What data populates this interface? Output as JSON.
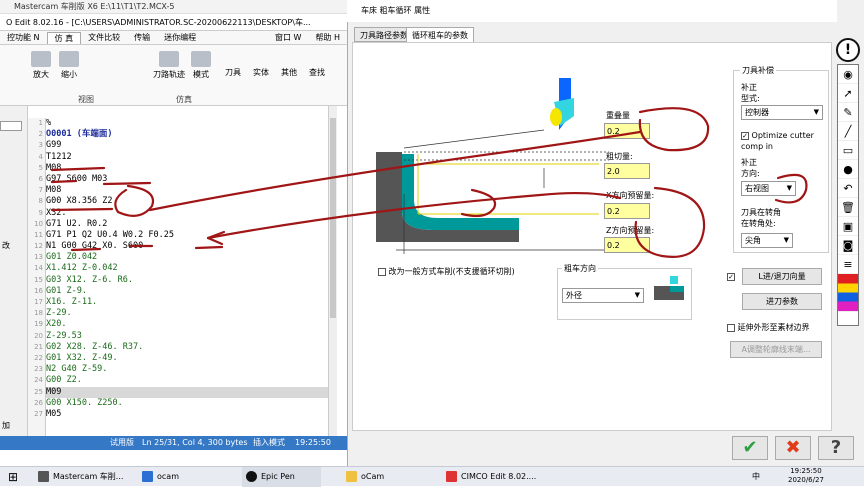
{
  "mastercam_title": "Mastercam 车削版 X6  E:\\11\\T1\\T2.MCX-5",
  "cimco": {
    "title": "O Edit 8.02.16 - [C:\\USERS\\ADMINISTRATOR.SC-20200622113\\DESKTOP\\车...",
    "tabs": [
      "控功能 N",
      "仿 真",
      "文件比较",
      "传输",
      "迷你编程"
    ],
    "right_menu": [
      "窗口 W",
      "帮助 H"
    ],
    "ribbon": {
      "buttons": [
        "放大",
        "缩小",
        "刀路轨迹",
        "模式",
        "刀具",
        "实体",
        "其他",
        "查找"
      ],
      "groups": [
        "视图",
        "仿真"
      ]
    },
    "left_panel": [
      "改",
      "加"
    ],
    "code_lines": [
      "%",
      "O0001 (车端面)",
      "G99",
      "T1212",
      "M08",
      "G97 S600 M03",
      "M08",
      "G00 X8.356 Z2.",
      "X32.",
      "G71 U2. R0.2",
      "G71 P1 Q2 U0.4 W0.2 F0.25",
      "N1 G00 G42 X0. S600",
      "G01 Z0.042",
      "X1.412 Z-0.042",
      "G03 X12. Z-6. R6.",
      "G01 Z-9.",
      "X16. Z-11.",
      "Z-29.",
      "X20.",
      "Z-29.53",
      "G02 X28. Z-46. R37.",
      "G01 X32. Z-49.",
      "N2 G40 Z-59.",
      "G00 Z2.",
      "M09",
      "G00 X150. Z250.",
      "M05"
    ],
    "highlight_index": 24,
    "status": {
      "mode": "试用版",
      "pos": "Ln 25/31, Col 4, 300 bytes",
      "insert": "插入模式",
      "time": "19:25:50"
    }
  },
  "dialog": {
    "title": "车床 粗车循环 属性",
    "tabs": [
      "刀具路径参数",
      "循环粗车的参数"
    ],
    "params": {
      "overlap_label": "重叠量",
      "overlap": "0.2",
      "depth_label": "粗切量:",
      "depth": "2.0",
      "x_stock_label": "X方向预留量:",
      "x_stock": "0.2",
      "z_stock_label": "Z方向预留量:",
      "z_stock": "0.2"
    },
    "change_mode_label": "改为一般方式车削(不支援循环切削)",
    "rough_dir_label": "粗车方向",
    "rough_dir_value": "外径",
    "comp": {
      "group_label": "刀具补偿",
      "type_label1": "补正",
      "type_label2": "型式:",
      "type_value": "控制器",
      "optimize_label": "Optimize cutter comp in",
      "dir_label1": "补正",
      "dir_label2": "方向:",
      "dir_value": "右视图",
      "corner_label1": "刀具在转角",
      "corner_label2": "在转角处:",
      "corner_value": "尖角"
    },
    "leadin_button": "L进/退刀向量",
    "infeed_button": "进刀参数",
    "extend_label": "延伸外形至素材边界",
    "adjust_button": "A调整轮廓线末端...",
    "ok": "✔",
    "cancel": "✖",
    "help": "?"
  },
  "colors": {
    "accent_blue": "#3478c6",
    "param_yellow": "#ffffa0",
    "ok_green": "#2ea043",
    "cancel_red": "#e03c1c",
    "annotation": "#a01515"
  },
  "taskbar": {
    "items": [
      "Mastercam 车削...",
      "ocam",
      "Epic Pen",
      "oCam",
      "CIMCO Edit 8.02...."
    ],
    "tray_lang": "中",
    "time": "19:25:50",
    "date": "2020/6/27"
  }
}
